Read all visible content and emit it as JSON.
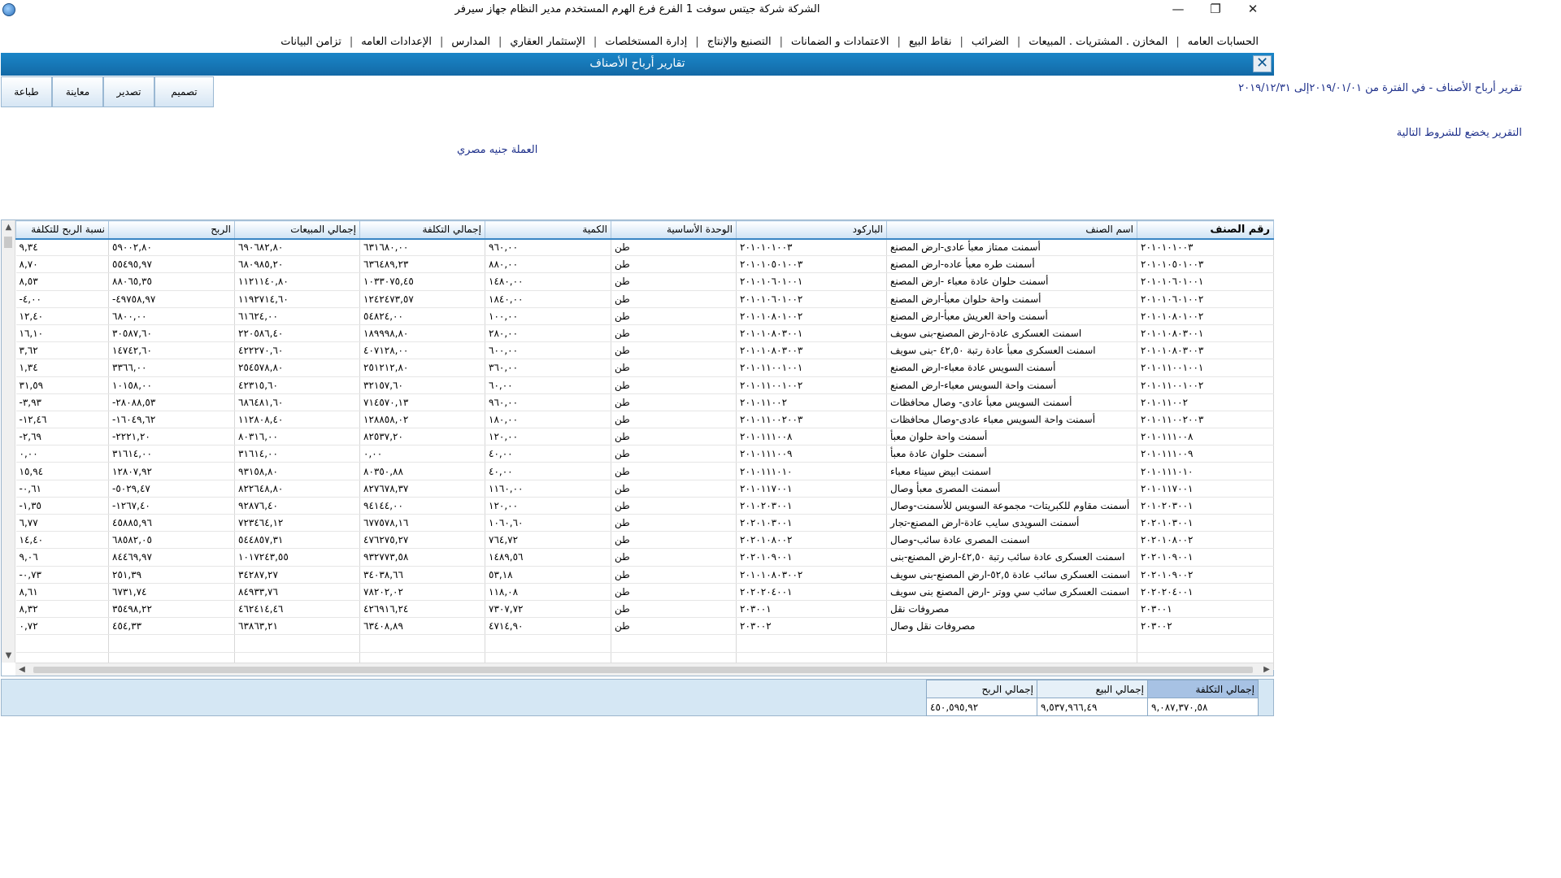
{
  "window": {
    "title": "الشركة شركة جيتس سوفت 1   الفرع فرع الهرم   المستخدم مدير النظام  جهاز سيرفر",
    "min_glyph": "—",
    "max_glyph": "❐",
    "close_glyph": "✕"
  },
  "menu": [
    "الحسابات العامه",
    "المخازن . المشتريات . المبيعات",
    "الضرائب",
    "نقاط البيع",
    "الاعتمادات و الضمانات",
    "التصنيع والإنتاج",
    "إدارة المستخلصات",
    "الإستثمار العقاري",
    "المدارس",
    "الإعدادات العامه",
    "تزامن البيانات"
  ],
  "report_header": {
    "title": "تقارير أرباح الأصناف",
    "close_glyph": "✕"
  },
  "toolbar": {
    "design": "تصميم",
    "export": "تصدير",
    "preview": "معاينة",
    "print": "طباعة"
  },
  "caption": "تقرير أرباح الأصناف -    في الفترة من ٢٠١٩/٠١/٠١إلى ٢٠١٩/١٢/٣١",
  "conditions": "التقرير يخضع للشروط التالية",
  "currency": "العملة جنيه مصري",
  "columns": [
    "رقم الصنف",
    "اسم الصنف",
    "الباركود",
    "الوحدة الأساسية",
    "الكمية",
    "إجمالي التكلفة",
    "إجمالي المبيعات",
    "الربح",
    "نسبة الربح للتكلفة"
  ],
  "rows": [
    [
      "٢٠١٠١٠١٠٠٣",
      "أسمنت ممتاز معبأ عادى-ارض المصنع",
      "٢٠١٠١٠١٠٠٣",
      "طن",
      "٩٦٠,٠٠",
      "٦٣١٦٨٠,٠٠",
      "٦٩٠٦٨٢,٨٠",
      "٥٩٠٠٢,٨٠",
      "٩,٣٤"
    ],
    [
      "٢٠١٠١٠٥٠١٠٠٣",
      "أسمنت طره معبأ عاده-ارض المصنع",
      "٢٠١٠١٠٥٠١٠٠٣",
      "طن",
      "٨٨٠,٠٠",
      "٦٣٦٤٨٩,٢٣",
      "٦٨٠٩٨٥,٢٠",
      "٥٥٤٩٥,٩٧",
      "٨,٧٠"
    ],
    [
      "٢٠١٠١٠٦٠١٠٠١",
      "أسمنت حلوان عادة معباء -ارض المصنع",
      "٢٠١٠١٠٦٠١٠٠١",
      "طن",
      "١٤٨٠,٠٠",
      "١٠٣٣٠٧٥,٤٥",
      "١١٢١١٤٠,٨٠",
      "٨٨٠٦٥,٣٥",
      "٨,٥٣"
    ],
    [
      "٢٠١٠١٠٦٠١٠٠٢",
      "أسمنت واحة حلوان معبأ-ارض المصنع",
      "٢٠١٠١٠٦٠١٠٠٢",
      "طن",
      "١٨٤٠,٠٠",
      "١٢٤٢٤٧٣,٥٧",
      "١١٩٢٧١٤,٦٠",
      "-٤٩٧٥٨,٩٧",
      "-٤,٠٠"
    ],
    [
      "٢٠١٠١٠٨٠١٠٠٢",
      "أسمنت واحة العريش معبأ-ارض المصنع",
      "٢٠١٠١٠٨٠١٠٠٢",
      "طن",
      "١٠٠,٠٠",
      "٥٤٨٢٤,٠٠",
      "٦١٦٢٤,٠٠",
      "٦٨٠٠,٠٠",
      "١٢,٤٠"
    ],
    [
      "٢٠١٠١٠٨٠٣٠٠١",
      "اسمنت العسكرى عادة-ارض المصنع-بنى سويف",
      "٢٠١٠١٠٨٠٣٠٠١",
      "طن",
      "٢٨٠,٠٠",
      "١٨٩٩٩٨,٨٠",
      "٢٢٠٥٨٦,٤٠",
      "٣٠٥٨٧,٦٠",
      "١٦,١٠"
    ],
    [
      "٢٠١٠١٠٨٠٣٠٠٣",
      "اسمنت العسكرى معبأ عادة رتبة ٤٢,٥٠ -بنى سويف",
      "٢٠١٠١٠٨٠٣٠٠٣",
      "طن",
      "٦٠٠,٠٠",
      "٤٠٧١٢٨,٠٠",
      "٤٢٢٢٧٠,٦٠",
      "١٤٧٤٢,٦٠",
      "٣,٦٢"
    ],
    [
      "٢٠١٠١١٠٠١٠٠١",
      "أسمنت السويس عادة معباء-ارض المصنع",
      "٢٠١٠١١٠٠١٠٠١",
      "طن",
      "٣٦٠,٠٠",
      "٢٥١٢١٢,٨٠",
      "٢٥٤٥٧٨,٨٠",
      "٣٣٦٦,٠٠",
      "١,٣٤"
    ],
    [
      "٢٠١٠١١٠٠١٠٠٢",
      "أسمنت واحة السويس معباء-ارض المصنع",
      "٢٠١٠١١٠٠١٠٠٢",
      "طن",
      "٦٠,٠٠",
      "٣٢١٥٧,٦٠",
      "٤٢٣١٥,٦٠",
      "١٠١٥٨,٠٠",
      "٣١,٥٩"
    ],
    [
      "٢٠١٠١١٠٠٢",
      "أسمنت السويس معبأ عادى- وصال محافظات",
      "٢٠١٠١١٠٠٢",
      "طن",
      "٩٦٠,٠٠",
      "٧١٤٥٧٠,١٣",
      "٦٨٦٤٨١,٦٠",
      "-٢٨٠٨٨,٥٣",
      "-٣,٩٣"
    ],
    [
      "٢٠١٠١١٠٠٢٠٠٣",
      "أسمنت واحة السويس معباء عادى-وصال محافظات",
      "٢٠١٠١١٠٠٢٠٠٣",
      "طن",
      "١٨٠,٠٠",
      "١٢٨٨٥٨,٠٢",
      "١١٢٨٠٨,٤٠",
      "-١٦٠٤٩,٦٢",
      "-١٢,٤٦"
    ],
    [
      "٢٠١٠١١١٠٠٨",
      "أسمنت واحة حلوان معبأ",
      "٢٠١٠١١١٠٠٨",
      "طن",
      "١٢٠,٠٠",
      "٨٢٥٣٧,٢٠",
      "٨٠٣١٦,٠٠",
      "-٢٢٢١,٢٠",
      "-٢,٦٩"
    ],
    [
      "٢٠١٠١١١٠٠٩",
      "أسمنت حلوان عادة معبأ",
      "٢٠١٠١١١٠٠٩",
      "طن",
      "٤٠,٠٠",
      "٠,٠٠",
      "٣١٦١٤,٠٠",
      "٣١٦١٤,٠٠",
      "٠,٠٠"
    ],
    [
      "٢٠١٠١١١٠١٠",
      "اسمنت ابيض سيناء معباء",
      "٢٠١٠١١١٠١٠",
      "طن",
      "٤٠,٠٠",
      "٨٠٣٥٠,٨٨",
      "٩٣١٥٨,٨٠",
      "١٢٨٠٧,٩٢",
      "١٥,٩٤"
    ],
    [
      "٢٠١٠١١٧٠٠١",
      "أسمنت المصرى معبأ وصال",
      "٢٠١٠١١٧٠٠١",
      "طن",
      "١١٦٠,٠٠",
      "٨٢٧٦٧٨,٣٧",
      "٨٢٢٦٤٨,٨٠",
      "-٥٠٢٩,٤٧",
      "-٠,٦١"
    ],
    [
      "٢٠١٠٢٠٣٠٠١",
      "أسمنت مقاوم للكبريتات- مجموعة السويس للأسمنت-وصال",
      "٢٠١٠٢٠٣٠٠١",
      "طن",
      "١٢٠,٠٠",
      "٩٤١٤٤,٠٠",
      "٩٢٨٧٦,٤٠",
      "-١٢٦٧,٤٠",
      "-١,٣٥"
    ],
    [
      "٢٠٢٠١٠٣٠٠١",
      "أسمنت السويدى سايب عادة-ارض المصنع-تجار",
      "٢٠٢٠١٠٣٠٠١",
      "طن",
      "١٠٦٠,٦٠",
      "٦٧٧٥٧٨,١٦",
      "٧٢٣٤٦٤,١٢",
      "٤٥٨٨٥,٩٦",
      "٦,٧٧"
    ],
    [
      "٢٠٢٠١٠٨٠٠٢",
      "اسمنت المصرى عادة سائب-وصال",
      "٢٠٢٠١٠٨٠٠٢",
      "طن",
      "٧٦٤,٧٢",
      "٤٧٦٢٧٥,٢٧",
      "٥٤٤٨٥٧,٣١",
      "٦٨٥٨٢,٠٥",
      "١٤,٤٠"
    ],
    [
      "٢٠٢٠١٠٩٠٠١",
      "اسمنت العسكرى عادة سائب رتبة ٤٢,٥٠-ارض المصنع-بنى",
      "٢٠٢٠١٠٩٠٠١",
      "طن",
      "١٤٨٩,٥٦",
      "٩٣٢٧٧٣,٥٨",
      "١٠١٧٢٤٣,٥٥",
      "٨٤٤٦٩,٩٧",
      "٩,٠٦"
    ],
    [
      "٢٠٢٠١٠٩٠٠٢",
      "اسمنت العسكرى سائب عادة ٥٢,٥-ارض المصنع-بنى سويف",
      "٢٠١٠١٠٨٠٣٠٠٢",
      "طن",
      "٥٣,١٨",
      "٣٤٠٣٨,٦٦",
      "٣٤٢٨٧,٢٧",
      "٢٥١,٣٩",
      "-٠,٧٣"
    ],
    [
      "٢٠٢٠٢٠٤٠٠١",
      "اسمنت العسكرى سائب سي ووتر -ارض المصنع بنى سويف",
      "٢٠٢٠٢٠٤٠٠١",
      "طن",
      "١١٨,٠٨",
      "٧٨٢٠٢,٠٢",
      "٨٤٩٣٣,٧٦",
      "٦٧٣١,٧٤",
      "٨,٦١"
    ],
    [
      "٢٠٣٠٠١",
      "مصروفات نقل",
      "٢٠٣٠٠١",
      "طن",
      "٧٣٠٧,٧٢",
      "٤٢٦٩١٦,٢٤",
      "٤٦٢٤١٤,٤٦",
      "٣٥٤٩٨,٢٢",
      "٨,٣٢"
    ],
    [
      "٢٠٣٠٠٢",
      "مصروفات نقل وصال",
      "٢٠٣٠٠٢",
      "طن",
      "٤٧١٤,٩٠",
      "٦٣٤٠٨,٨٩",
      "٦٣٨٦٣,٢١",
      "٤٥٤,٣٣",
      "٠,٧٢"
    ]
  ],
  "totals": {
    "cost_label": "إجمالي التكلفة",
    "sales_label": "إجمالي البيع",
    "profit_label": "إجمالي الربح",
    "cost_value": "٩,٠٨٧,٣٧٠,٥٨",
    "sales_value": "٩,٥٣٧,٩٦٦,٤٩",
    "profit_value": "٤٥٠,٥٩٥,٩٢"
  },
  "colors": {
    "header_blue": "#1a86c8",
    "text_blue": "#1d2f8a"
  }
}
